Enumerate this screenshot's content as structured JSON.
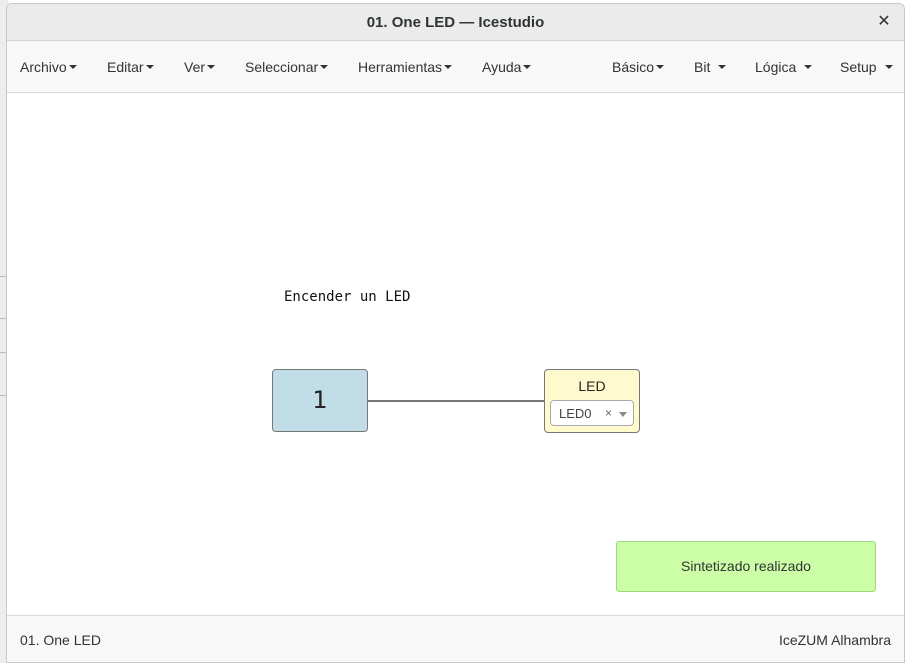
{
  "window": {
    "title": "01. One LED — Icestudio",
    "close_glyph": "✕"
  },
  "menu": {
    "left": [
      {
        "label": "Archivo"
      },
      {
        "label": "Editar"
      },
      {
        "label": "Ver"
      },
      {
        "label": "Seleccionar"
      },
      {
        "label": "Herramientas"
      },
      {
        "label": "Ayuda"
      }
    ],
    "right": [
      {
        "label": "Básico"
      },
      {
        "label": "Bit"
      },
      {
        "label": "Lógica"
      },
      {
        "label": "Setup"
      }
    ]
  },
  "canvas": {
    "comment": "Encender un LED",
    "constant_block": {
      "value": "1",
      "color": "#c1dde8"
    },
    "led_block": {
      "title": "LED",
      "selected_pin": "LED0",
      "clear_glyph": "×",
      "color": "#fffacd"
    }
  },
  "notification": {
    "text": "Sintetizado realizado",
    "color": "#ccfea8"
  },
  "footer": {
    "project_name": "01. One LED",
    "board_name": "IceZUM Alhambra"
  }
}
